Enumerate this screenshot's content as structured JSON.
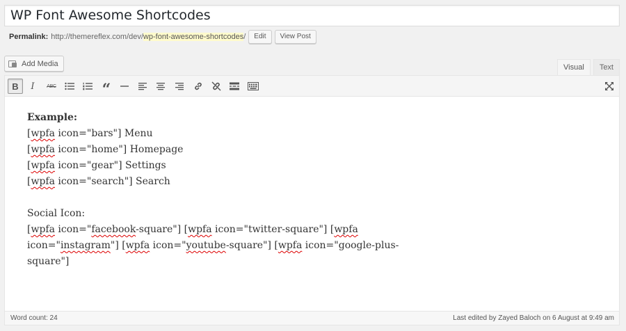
{
  "post": {
    "title": "WP Font Awesome Shortcodes"
  },
  "permalink": {
    "label": "Permalink:",
    "base": "http://themereflex.com/dev/",
    "slug": "wp-font-awesome-shortcodes",
    "trail": "/",
    "edit_label": "Edit",
    "view_label": "View Post"
  },
  "media": {
    "add_label": "Add Media"
  },
  "modes": {
    "visual": "Visual",
    "text": "Text",
    "active": "visual"
  },
  "toolbar": {
    "bold": "B",
    "italic": "I",
    "strike": "ABC",
    "quote": "“"
  },
  "content": {
    "example_heading": "Example:",
    "shortcode_lines": [
      {
        "tag": "wpfa",
        "rest": " icon=\"bars\"] Menu"
      },
      {
        "tag": "wpfa",
        "rest": " icon=\"home\"] Homepage"
      },
      {
        "tag": "wpfa",
        "rest": " icon=\"gear\"] Settings"
      },
      {
        "tag": "wpfa",
        "rest": " icon=\"search\"] Search"
      }
    ],
    "social_heading": "Social Icon:",
    "social_lines": {
      "l1_a": "[",
      "l1_tag1": "wpfa",
      "l1_b": " icon=\"",
      "l1_word1": "facebook",
      "l1_c": "-square\"] [",
      "l1_tag2": "wpfa",
      "l1_d": " icon=\"twitter-square\"] [",
      "l1_tag3": "wpfa",
      "l2_a": "icon=\"",
      "l2_word1": "instagram",
      "l2_b": "\"] [",
      "l2_tag1": "wpfa",
      "l2_c": " icon=\"",
      "l2_word2": "youtube",
      "l2_d": "-square\"] [",
      "l2_tag2": "wpfa",
      "l2_e": " icon=\"google-plus-",
      "l3": "square\"]"
    }
  },
  "status": {
    "word_count": "Word count: 24",
    "last_edited": "Last edited by Zayed Baloch on 6 August at 9:49 am"
  }
}
